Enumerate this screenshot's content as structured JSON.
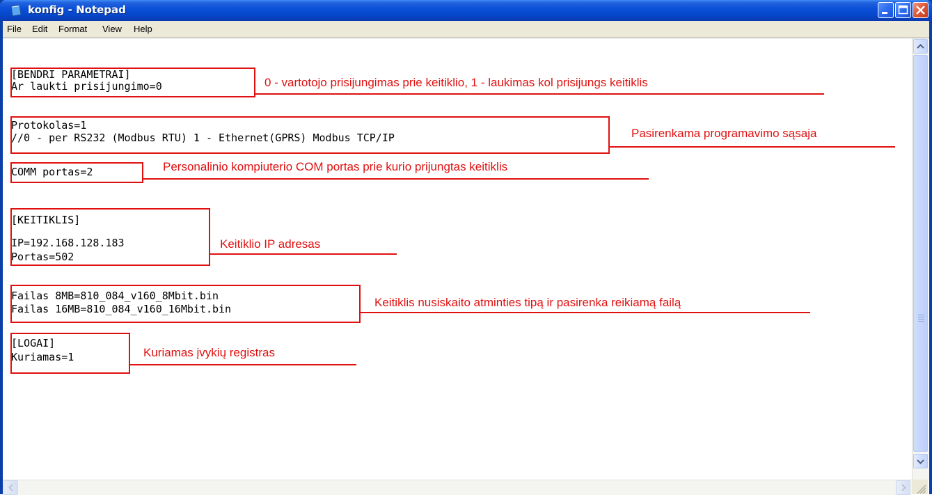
{
  "window": {
    "title": "konfig - Notepad",
    "icon": "notepad-icon",
    "controls": [
      "minimize-icon",
      "maximize-icon",
      "close-icon"
    ]
  },
  "menu": [
    "File",
    "Edit",
    "Format",
    "View",
    "Help"
  ],
  "content_lines": [
    "[BENDRI PARAMETRAI]",
    "Ar laukti prisijungimo=0",
    "Protokolas=1",
    "//0 - per RS232 (Modbus RTU) 1 - Ethernet(GPRS) Modbus TCP/IP",
    "COMM portas=2",
    "[KEITIKLIS]",
    "IP=192.168.128.183",
    "Portas=502",
    "Failas 8MB=810_084_v160_8Mbit.bin",
    "Failas 16MB=810_084_v160_16Mbit.bin",
    "[LOGAI]",
    "Kuriamas=1"
  ],
  "annotations": [
    "0 - vartotojo prisijungimas prie keitiklio, 1 - laukimas kol prisijungs keitiklis",
    "Pasirenkama programavimo sąsaja",
    "Personalinio kompiuterio COM portas prie kurio prijungtas keitiklis",
    "Keitiklio IP adresas",
    "Keitiklis nusiskaito atminties tipą ir pasirenka reikiamą failą",
    "Kuriamas įvykių registras"
  ],
  "colors": {
    "annotation": "#e01010",
    "titlebar": "#0a50d8",
    "menubar": "#ece9d8"
  }
}
